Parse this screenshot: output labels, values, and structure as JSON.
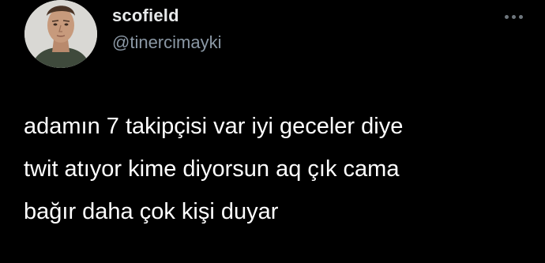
{
  "author": {
    "display_name": "scofield",
    "handle": "@tinercimayki",
    "avatar_icon": "profile-photo"
  },
  "more_icon": "ellipsis-icon",
  "tweet": {
    "lines": [
      "adamın 7 takipçisi var iyi geceler diye",
      "twit atıyor kime diyorsun aq çık cama",
      "bağır daha çok kişi duyar"
    ]
  },
  "colors": {
    "background": "#000000",
    "text": "#ffffff",
    "handle": "#8b98a5",
    "more_dots": "#6e767d"
  }
}
